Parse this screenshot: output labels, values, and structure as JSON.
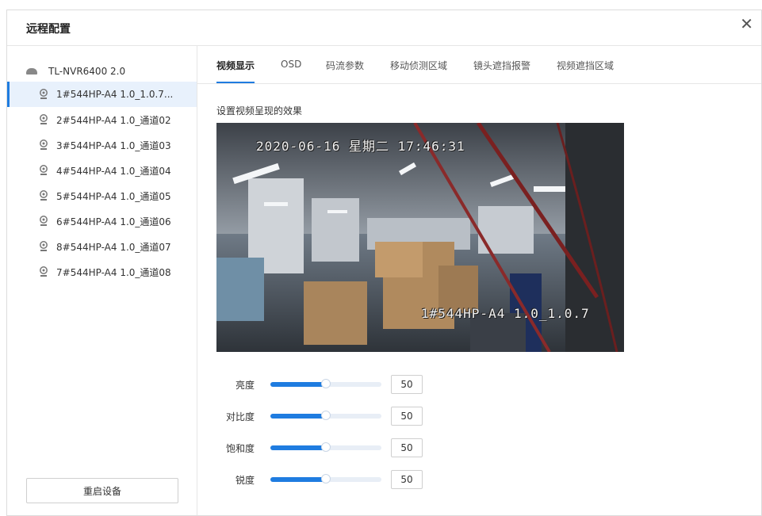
{
  "dialog": {
    "title": "远程配置",
    "close_glyph": "✕"
  },
  "sidebar": {
    "device_name": "TL-NVR6400 2.0",
    "channels": [
      {
        "label": "1#544HP-A4 1.0_1.0.7...",
        "active": true
      },
      {
        "label": "2#544HP-A4 1.0_通道02"
      },
      {
        "label": "3#544HP-A4 1.0_通道03"
      },
      {
        "label": "4#544HP-A4 1.0_通道04"
      },
      {
        "label": "5#544HP-A4 1.0_通道05"
      },
      {
        "label": "6#544HP-A4 1.0_通道06"
      },
      {
        "label": "8#544HP-A4 1.0_通道07"
      },
      {
        "label": "7#544HP-A4 1.0_通道08"
      }
    ],
    "restart_label": "重启设备"
  },
  "tabs": [
    {
      "label": "视频显示",
      "active": true
    },
    {
      "label": "OSD"
    },
    {
      "label": "码流参数"
    },
    {
      "label": "移动侦测区域"
    },
    {
      "label": "镜头遮挡报警"
    },
    {
      "label": "视频遮挡区域"
    }
  ],
  "video": {
    "section_label": "设置视频呈现的效果",
    "osd_time": "2020-06-16 星期二 17:46:31",
    "osd_name": "1#544HP-A4 1.0_1.0.7"
  },
  "adjustments": [
    {
      "label": "亮度",
      "value": "50",
      "fraction": 0.5
    },
    {
      "label": "对比度",
      "value": "50",
      "fraction": 0.5
    },
    {
      "label": "饱和度",
      "value": "50",
      "fraction": 0.5
    },
    {
      "label": "锐度",
      "value": "50",
      "fraction": 0.5
    }
  ],
  "colors": {
    "accent": "#1f7ce0",
    "active_bg": "#e8f1fc"
  }
}
